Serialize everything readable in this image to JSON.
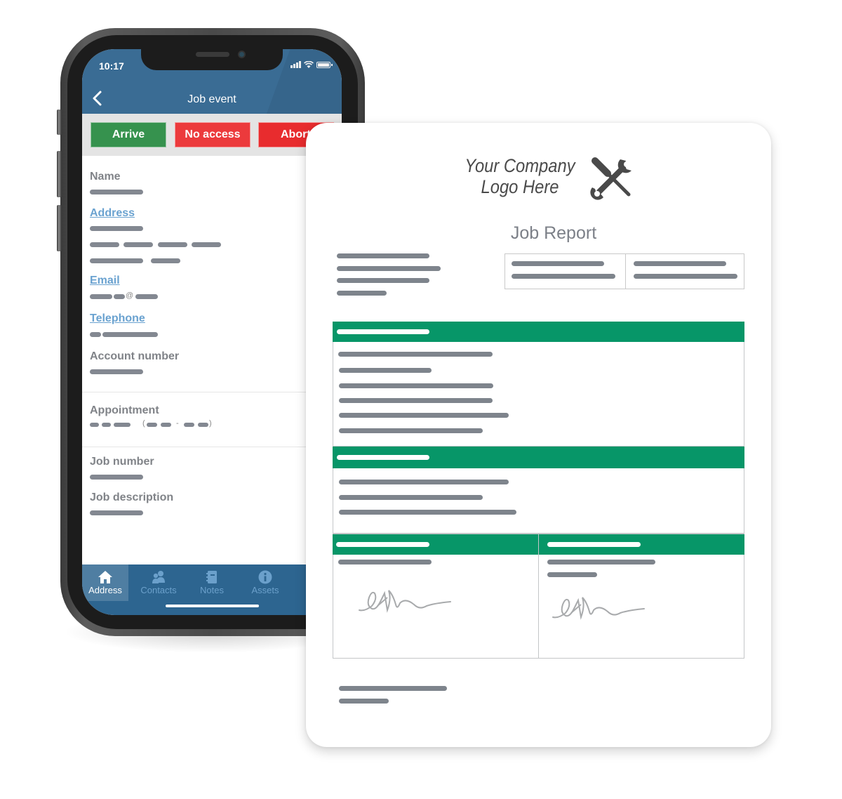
{
  "phone": {
    "status": {
      "time": "10:17",
      "icons": [
        "signal-icon",
        "wifi-icon",
        "battery-icon"
      ]
    },
    "header": {
      "back_icon": "chevron-left-icon",
      "title": "Job event"
    },
    "actions": [
      {
        "label": "Arrive",
        "color": "#36924e"
      },
      {
        "label": "No access",
        "color": "#ec3a3c"
      },
      {
        "label": "Abort",
        "color": "#e82c2e"
      }
    ],
    "fields": {
      "name": "Name",
      "address": "Address",
      "email": "Email",
      "email_at": "@",
      "telephone": "Telephone",
      "account_number": "Account number",
      "appointment": "Appointment",
      "appointment_open": "(",
      "appointment_dash": "-",
      "appointment_close": ")",
      "job_number": "Job number",
      "job_description": "Job description"
    },
    "bottom_nav": [
      {
        "label": "Address",
        "icon": "home-icon",
        "active": true
      },
      {
        "label": "Contacts",
        "icon": "contacts-icon",
        "active": false
      },
      {
        "label": "Notes",
        "icon": "notebook-icon",
        "active": false
      },
      {
        "label": "Assets",
        "icon": "info-icon",
        "active": false
      }
    ],
    "colors": {
      "header": "#3a6c94",
      "nav": "#2d6590",
      "link": "#6aa2d0"
    }
  },
  "report": {
    "logo_line1": "Your Company",
    "logo_line2": "Logo Here",
    "logo_icon": "tools-icon",
    "title": "Job Report",
    "colors": {
      "section_header": "#079668",
      "placeholder": "#7e848c"
    }
  }
}
